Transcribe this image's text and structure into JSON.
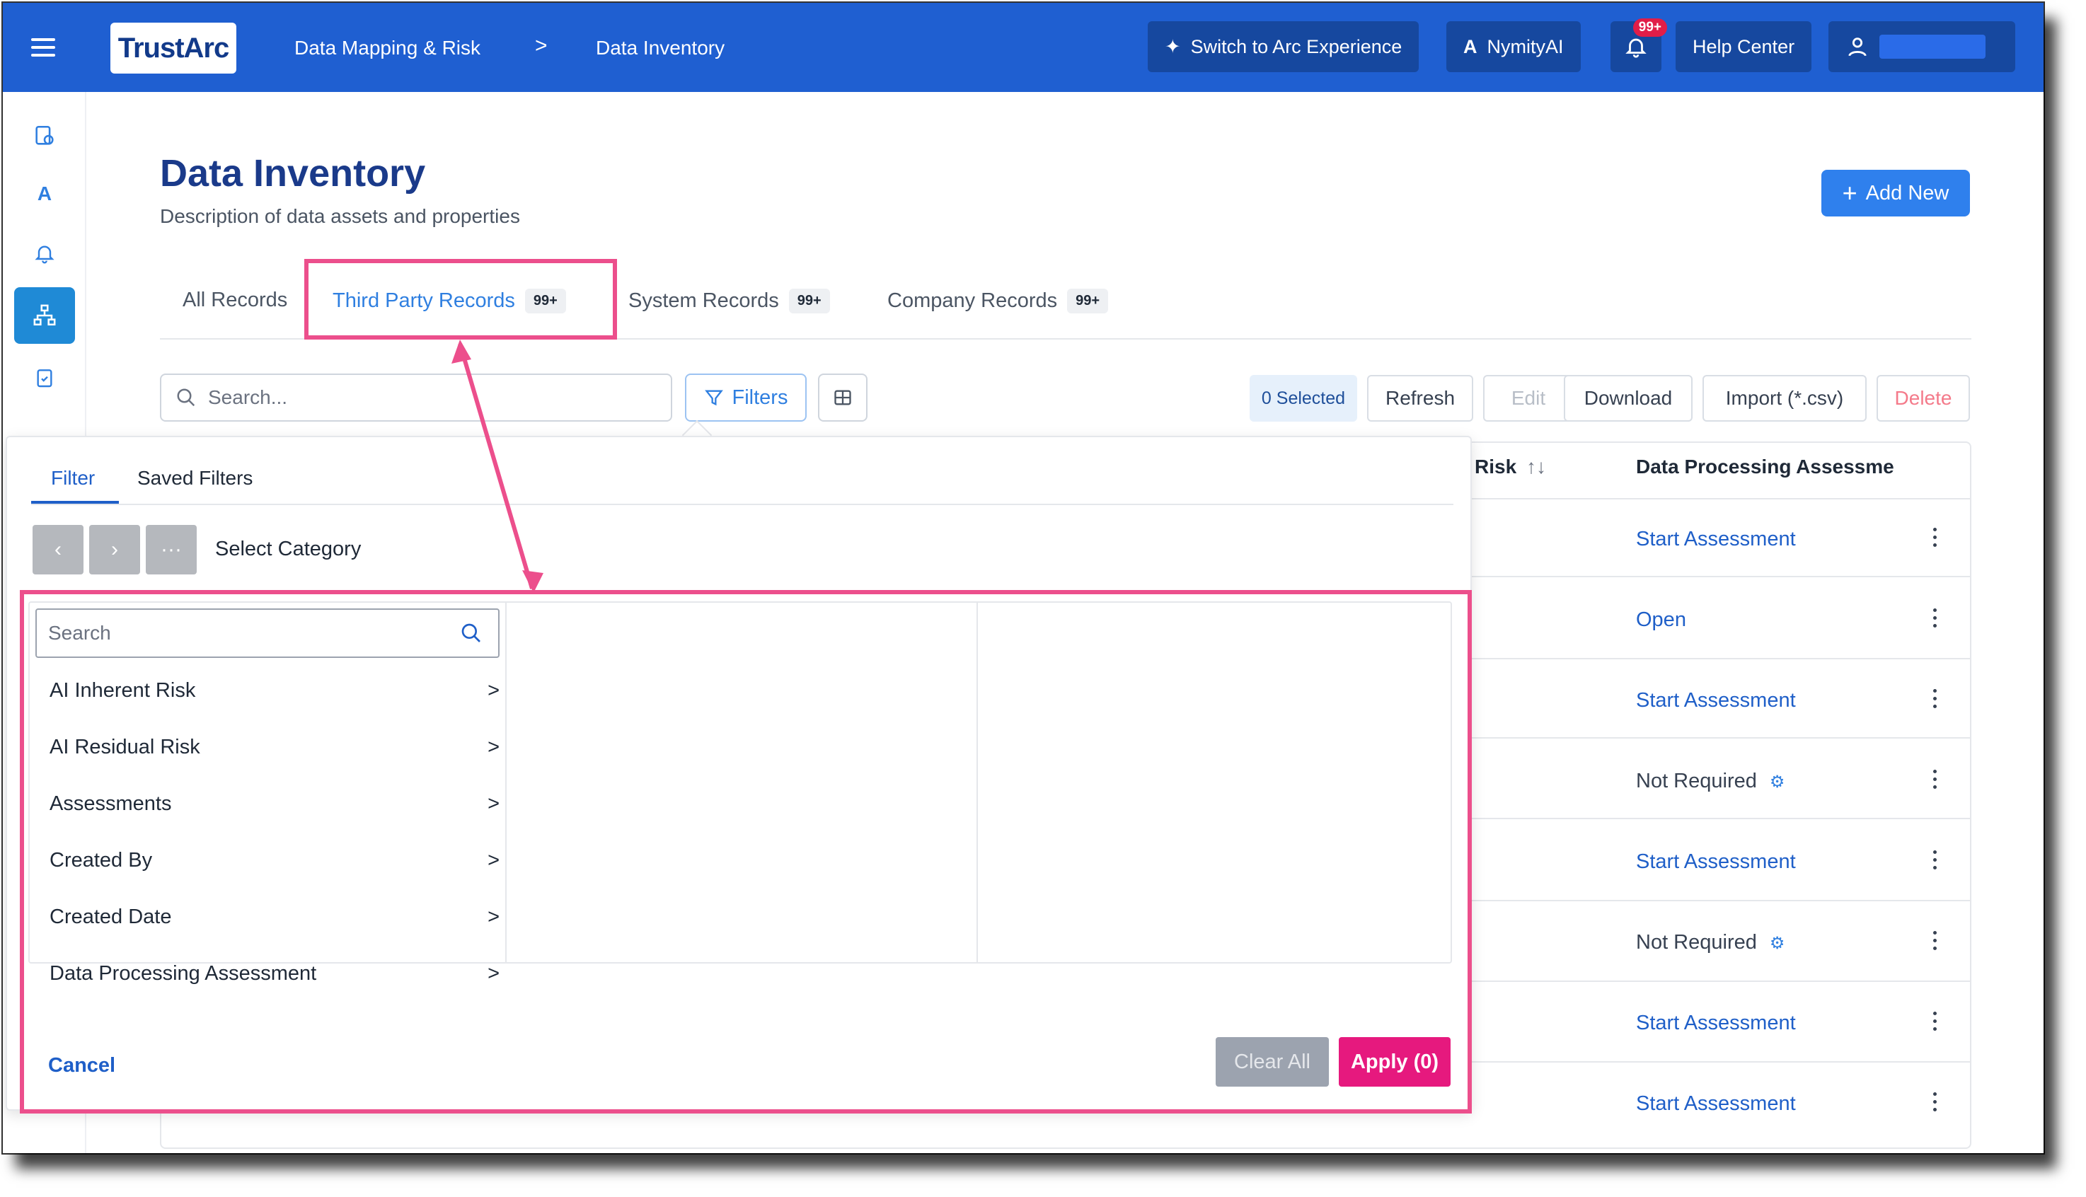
{
  "topbar": {
    "logo": "TrustArc",
    "breadcrumb_section": "Data Mapping & Risk",
    "breadcrumb_sep": ">",
    "breadcrumb_page": "Data Inventory",
    "switch_label": "Switch to Arc Experience",
    "nymity_label": "NymityAI",
    "notif_badge": "99+",
    "help_label": "Help Center"
  },
  "header": {
    "title": "Data Inventory",
    "description": "Description of data assets and properties",
    "add_new": "Add New"
  },
  "tabs": [
    {
      "label": "All Records",
      "count": ""
    },
    {
      "label": "Third Party Records",
      "count": "99+"
    },
    {
      "label": "System Records",
      "count": "99+"
    },
    {
      "label": "Company Records",
      "count": "99+"
    }
  ],
  "toolbar": {
    "search_placeholder": "Search...",
    "filters_label": "Filters",
    "selected_label": "0 Selected",
    "refresh": "Refresh",
    "edit": "Edit",
    "download": "Download",
    "import": "Import (*.csv)",
    "delete": "Delete"
  },
  "table": {
    "headers": [
      "Risk",
      "Data Processing Assessme"
    ],
    "rows": [
      {
        "assessment": "Start Assessment",
        "type": "link"
      },
      {
        "assessment": "Open",
        "type": "link"
      },
      {
        "assessment": "Start Assessment",
        "type": "link"
      },
      {
        "assessment": "Not Required",
        "type": "muted"
      },
      {
        "assessment": "Start Assessment",
        "type": "link"
      },
      {
        "assessment": "Not Required",
        "type": "muted"
      },
      {
        "assessment": "Start Assessment",
        "type": "link"
      },
      {
        "assessment": "Start Assessment",
        "type": "link"
      }
    ]
  },
  "filter_popover": {
    "tab_filter": "Filter",
    "tab_saved": "Saved Filters",
    "select_category": "Select Category",
    "search_placeholder": "Search",
    "categories": [
      "AI Inherent Risk",
      "AI Residual Risk",
      "Assessments",
      "Created By",
      "Created Date",
      "Data Processing Assessment"
    ],
    "chevron": ">",
    "cancel": "Cancel",
    "clear_all": "Clear All",
    "apply": "Apply (0)"
  },
  "colors": {
    "topbar": "#1f5fd1",
    "accent": "#2f7fe0",
    "annotation": "#ec4f8c",
    "apply": "#e6197e"
  }
}
